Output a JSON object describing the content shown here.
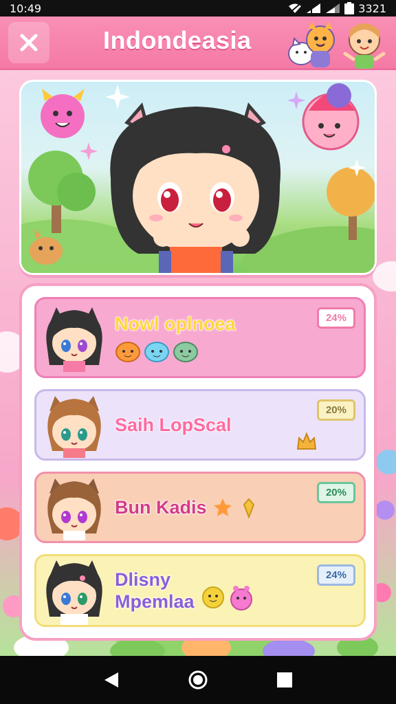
{
  "status_bar": {
    "time": "10:49",
    "battery": "3321"
  },
  "app_bar": {
    "title": "Indondeasia"
  },
  "cards": [
    {
      "name": "Nowl oplnoea",
      "badge": "24%",
      "name_color": "#ffd63a",
      "badge_color": "#f07aa8"
    },
    {
      "name": "Saih LopScal",
      "badge": "20%",
      "name_color": "#ff6aa0",
      "badge_color": "#e0c46a"
    },
    {
      "name": "Bun Kadis",
      "badge": "20%",
      "name_color": "#d23b86",
      "badge_color": "#6cc49a"
    },
    {
      "name": "Dlisny Mpemlaa",
      "badge": "24%",
      "name_color": "#8a5fd6",
      "badge_color": "#9ab8e0"
    }
  ],
  "icons": {
    "close": "close-icon",
    "back": "back-icon",
    "home": "home-icon",
    "recents": "recents-icon",
    "wifi": "wifi-icon",
    "signal": "signal-icon",
    "battery": "battery-icon"
  },
  "colors": {
    "primary_pink": "#f57aa6",
    "panel_border": "#f7a0c3",
    "background": "#f6b9d3"
  }
}
